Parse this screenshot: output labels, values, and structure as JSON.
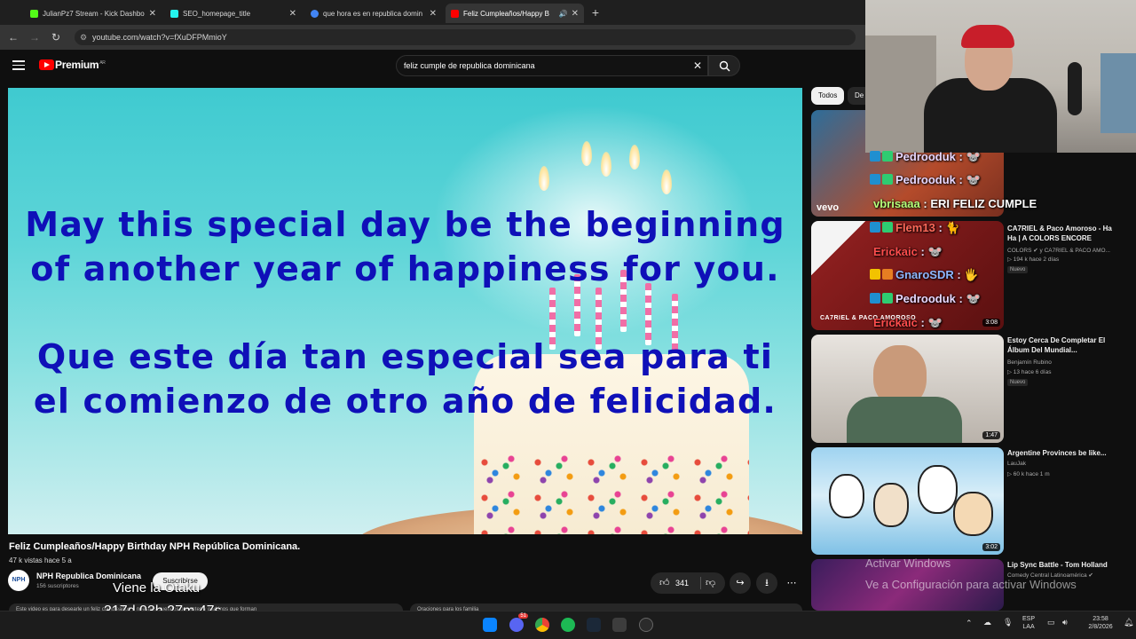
{
  "browser": {
    "tabs": [
      {
        "label": "JulianPz7 Stream - Kick Dashbo",
        "color": "#53fc18"
      },
      {
        "label": "SEO_homepage_title",
        "color": "#25f4ee"
      },
      {
        "label": "que hora es en republica domin",
        "color": "#4285f4"
      },
      {
        "label": "Feliz Cumpleaños/Happy B",
        "color": "#ff0000"
      }
    ],
    "url": "youtube.com/watch?v=fXuDFPMmioY"
  },
  "youtube": {
    "brand": "Premium",
    "brand_sup": "AR",
    "search_value": "feliz cumple de republica dominicana"
  },
  "video": {
    "lines_en": [
      "May this special day be the beginning",
      "of another year of happiness for you."
    ],
    "lines_es": [
      "Que este día tan especial sea para ti",
      "el comienzo de otro año de felicidad."
    ],
    "title": "Feliz Cumpleaños/Happy Birthday NPH República Dominicana.",
    "meta": "47 k vistas  hace 5 a",
    "channel_name": "NPH Republica Dominicana",
    "channel_subs": "156 suscriptores",
    "channel_avatar": "NPH",
    "subscribe_label": "Suscribirse",
    "likes": "341",
    "description_left": "Este video es para desearle un feliz cumpleaños a nuestros queridos donantes y padrinos que forman",
    "description_right": "Oraciones para los familia"
  },
  "sidebar": {
    "chips": [
      "Todos",
      "De"
    ],
    "items": [
      {
        "title": "",
        "channel": "vevo",
        "stats": "",
        "duration": ""
      },
      {
        "title": "CA7RIEL & Paco Amoroso - Ha Ha | A COLORS ENCORE",
        "channel": "COLORS ✔ y CA7RIEL & PACO AMO...",
        "stats": "▷ 194 k  hace 2 días",
        "badge": "Nuevo",
        "duration": "3:08",
        "thumb_label": "CA7RIEL & PACO AMOROSO"
      },
      {
        "title": "Estoy Cerca De Completar El Álbum Del Mundial...",
        "channel": "Benjamín Rubino",
        "stats": "▷ 13  hace 6 días",
        "badge": "Nuevo",
        "duration": "1:47"
      },
      {
        "title": "Argentine Provinces be like...",
        "channel": "LauJak",
        "stats": "▷ 60 k  hace 1 m",
        "duration": "3:02"
      },
      {
        "title": "Lip Sync Battle - Tom Holland",
        "channel": "Comedy Central Latinoamérica ✔",
        "stats": "",
        "duration": ""
      }
    ]
  },
  "chat": [
    {
      "user": "Pedrooduk",
      "msg": ": 🐭"
    },
    {
      "user": "Pedrooduk",
      "msg": ": 🐭"
    },
    {
      "user": "vbrisaaa",
      "msg": ": ERI FELIZ CUMPLE"
    },
    {
      "user": "Flem13",
      "msg": ": 🐈"
    },
    {
      "user": "Erickaic",
      "msg": ": 🐭"
    },
    {
      "user": "GnaroSDR",
      "msg": ": 🖐"
    },
    {
      "user": "Pedrooduk",
      "msg": ": 🐭"
    },
    {
      "user": "Erickaic",
      "msg": ": 🐭"
    }
  ],
  "overlay": {
    "caption": "Viene la Otaku",
    "countdown": "317d 03h 27m 47s",
    "activate_title": "Activar Windows",
    "activate_sub": "Ve a Configuración para activar Windows"
  },
  "taskbar": {
    "lang_top": "ESP",
    "lang_bottom": "LAA",
    "time": "23:58",
    "date": "2/8/2026",
    "discord_badge": "51"
  }
}
